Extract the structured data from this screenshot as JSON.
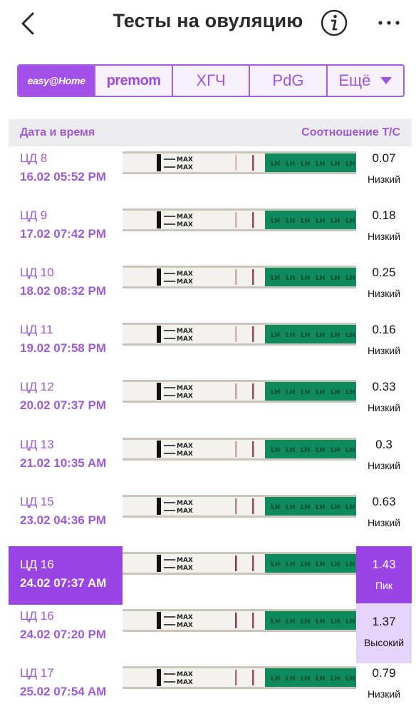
{
  "header": {
    "title": "Тесты на овуляцию"
  },
  "tabs": [
    {
      "label": "easy@Home",
      "active": true
    },
    {
      "label": "premom",
      "active": false
    },
    {
      "label": "ХГЧ",
      "active": false
    },
    {
      "label": "PdG",
      "active": false
    },
    {
      "label": "Ещё",
      "active": false
    }
  ],
  "columns": {
    "left": "Дата и время",
    "right": "Соотношение Т/С"
  },
  "strip_labels": {
    "max": "MAX",
    "lh": "LH"
  },
  "colors": {
    "accent": "#9b44e6",
    "accent_light": "#e6d3fb",
    "strip_green": "#0f8a5f"
  },
  "rows": [
    {
      "cd": "ЦД 8",
      "date": "16.02   05:52 PM",
      "ratio": "0.07",
      "level": "Низкий",
      "state": "normal"
    },
    {
      "cd": "ЦД 9",
      "date": "17.02   07:42 PM",
      "ratio": "0.18",
      "level": "Низкий",
      "state": "normal"
    },
    {
      "cd": "ЦД 10",
      "date": "18.02   08:32 PM",
      "ratio": "0.25",
      "level": "Низкий",
      "state": "normal"
    },
    {
      "cd": "ЦД 11",
      "date": "19.02   07:58 PM",
      "ratio": "0.16",
      "level": "Низкий",
      "state": "normal"
    },
    {
      "cd": "ЦД 12",
      "date": "20.02   07:37 PM",
      "ratio": "0.33",
      "level": "Низкий",
      "state": "normal"
    },
    {
      "cd": "ЦД 13",
      "date": "21.02   10:35 AM",
      "ratio": "0.3",
      "level": "Низкий",
      "state": "normal"
    },
    {
      "cd": "ЦД 15",
      "date": "23.02   04:36 PM",
      "ratio": "0.63",
      "level": "Низкий",
      "state": "normal"
    },
    {
      "cd": "ЦД 16",
      "date": "24.02   07:37 AM",
      "ratio": "1.43",
      "level": "Пик",
      "state": "selected"
    },
    {
      "cd": "ЦД 16",
      "date": "24.02   07:20 PM",
      "ratio": "1.37",
      "level": "Высокий",
      "state": "high"
    },
    {
      "cd": "ЦД 17",
      "date": "25.02   07:54 AM",
      "ratio": "0.79",
      "level": "Низкий",
      "state": "normal"
    }
  ]
}
